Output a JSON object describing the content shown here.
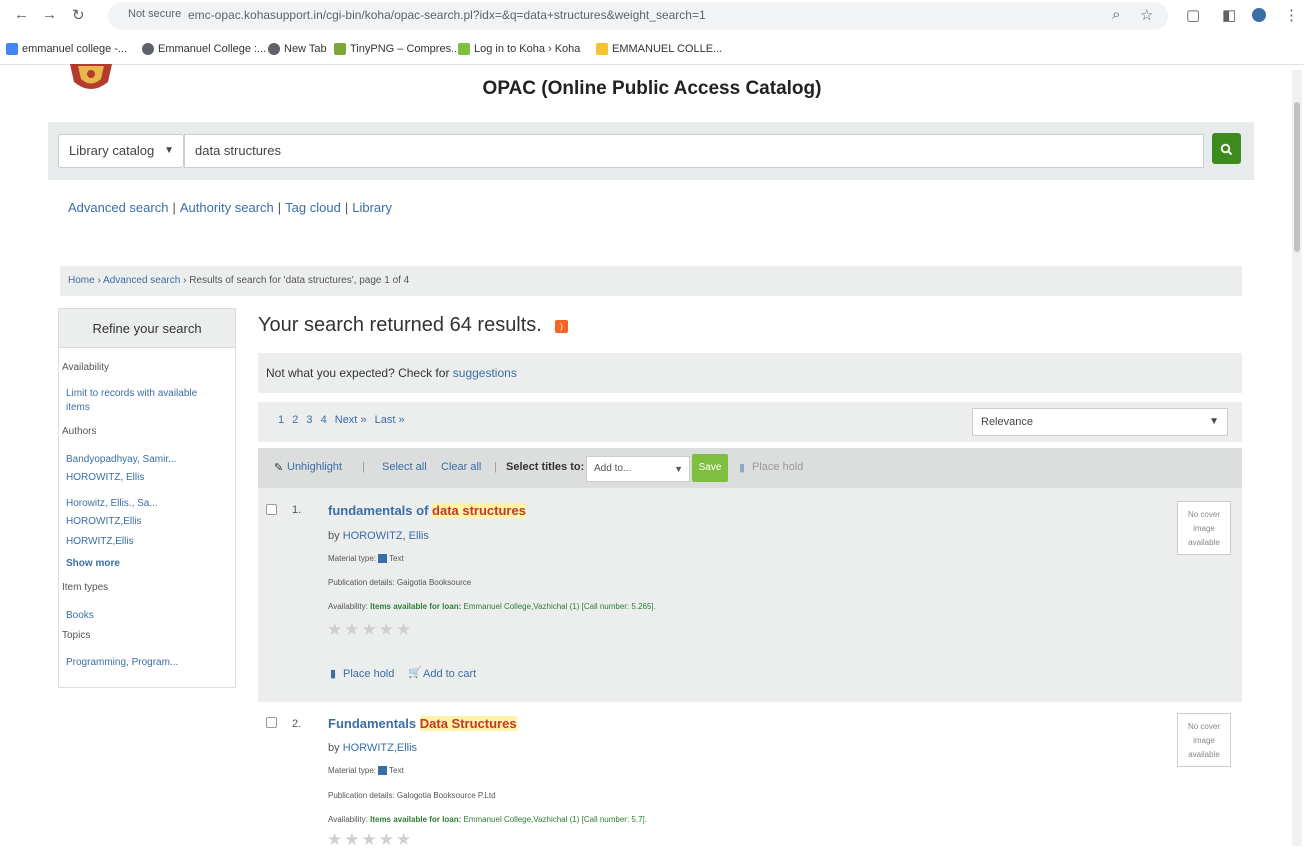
{
  "browser": {
    "security_label": "Not secure",
    "url": "emc-opac.kohasupport.in/cgi-bin/koha/opac-search.pl?idx=&q=data+structures&weight_search=1",
    "bookmarks": [
      {
        "label": "emmanuel college -...",
        "color": "#4285f4"
      },
      {
        "label": "Emmanuel College :...",
        "color": "#5f6368"
      },
      {
        "label": "New Tab",
        "color": "#5f6368"
      },
      {
        "label": "TinyPNG – Compres...",
        "color": "#7ba63a"
      },
      {
        "label": "Log in to Koha › Koha",
        "color": "#7fbf3f"
      },
      {
        "label": "EMMANUEL COLLE...",
        "color": "#f4c430"
      }
    ]
  },
  "header": {
    "title": "OPAC (Online Public Access Catalog)"
  },
  "search": {
    "scope": "Library catalog",
    "query": "data structures",
    "button_icon": "search-icon"
  },
  "links": {
    "advanced": "Advanced search",
    "authority": "Authority search",
    "tag_cloud": "Tag cloud",
    "library": "Library"
  },
  "breadcrumb": {
    "home": "Home",
    "advanced": "Advanced search",
    "current": "Results of search for 'data structures', page 1 of 4"
  },
  "refine": {
    "title": "Refine your search",
    "availability_heading": "Availability",
    "availability_link_1": "Limit to records with available",
    "availability_link_2": "items",
    "authors_heading": "Authors",
    "authors": [
      "Bandyopadhyay, Samir...",
      "HOROWITZ, Ellis",
      "Horowitz, Ellis., Sa...",
      "HOROWITZ,Ellis",
      "HORWITZ,Ellis"
    ],
    "show_more": "Show more",
    "item_types_heading": "Item types",
    "item_type": "Books",
    "topics_heading": "Topics",
    "topic": "Programming, Program..."
  },
  "results": {
    "heading": "Your search returned 64 results.",
    "suggest_text": "Not what you expected? Check for",
    "suggest_link": "suggestions",
    "pages": [
      "1",
      "2",
      "3",
      "4"
    ],
    "next": "Next »",
    "last": "Last »",
    "sort": "Relevance"
  },
  "toolbar": {
    "unhighlight": "Unhighlight",
    "select_all": "Select all",
    "clear_all": "Clear all",
    "select_titles": "Select titles to:",
    "add_to": "Add to...",
    "save": "Save",
    "place_hold": "Place hold"
  },
  "records": [
    {
      "number": "1.",
      "title_pre": "fundamentals of",
      "title_hl": "data structures",
      "by_label": "by",
      "author": "HOROWITZ, Ellis",
      "material_label": "Material type:",
      "material": "Text",
      "publication": "Publication details: Gaigotia Booksource",
      "avail_label": "Availability:",
      "avail_strong": "Items available for loan:",
      "avail_detail": "Emmanuel College,Vazhichal (1) [Call number: 5.265].",
      "cover": "No cover image available",
      "place_hold": "Place hold",
      "add_to_cart": "Add to cart"
    },
    {
      "number": "2.",
      "title_pre": "Fundamentals",
      "title_hl": "Data Structures",
      "by_label": "by",
      "author": "HORWITZ,Ellis",
      "material_label": "Material type:",
      "material": "Text",
      "publication": "Publication details: Galogotia Booksource P.Ltd",
      "avail_label": "Availability:",
      "avail_strong": "Items available for loan:",
      "avail_detail": "Emmanuel College,Vazhichal (1) [Call number: 5.7].",
      "cover": "No cover image available"
    }
  ]
}
